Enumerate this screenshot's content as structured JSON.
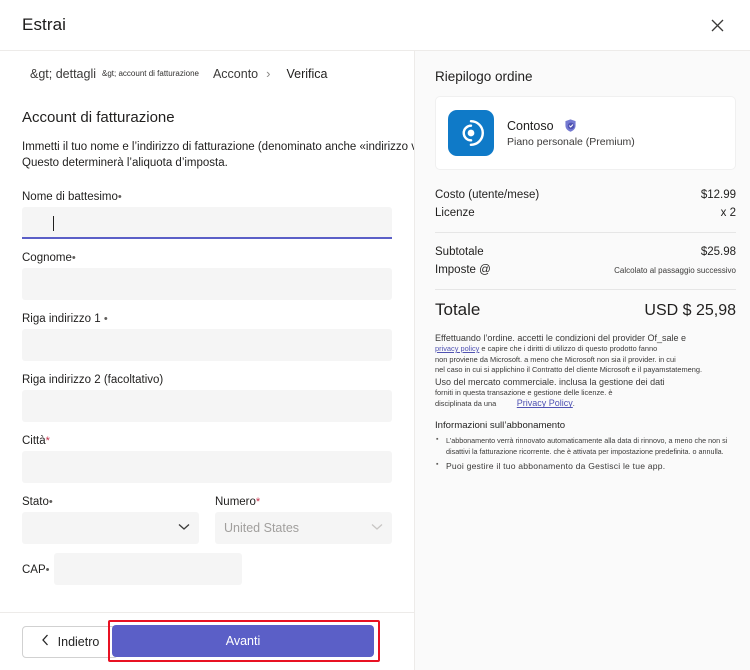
{
  "window": {
    "title": "Estrai",
    "close_icon": "close-icon"
  },
  "breadcrumb": {
    "items": [
      {
        "label": "&gt; dettagli",
        "style": "lg"
      },
      {
        "label": "&gt; account di fatturazione",
        "style": "small"
      },
      {
        "label": "Acconto",
        "style": "lg"
      },
      {
        "label": "Verifica",
        "style": "lg"
      }
    ],
    "separator": "›"
  },
  "form": {
    "section_title": "Account di fatturazione",
    "description_line1": "Immetti il tuo nome e l’indirizzo di fatturazione (denominato anche «indirizzo venduto a»).",
    "description_line2": "Questo determinerà l’aliquota d’imposta.",
    "fields": [
      {
        "label": "Nome di battesimo",
        "required": "•",
        "value": "",
        "type": "text",
        "focused": true
      },
      {
        "label": "Cognome",
        "required": "•",
        "value": "",
        "type": "text",
        "focused": false
      },
      {
        "label": "Riga indirizzo 1",
        "required": "•",
        "value": "",
        "type": "text",
        "focused": false
      },
      {
        "label": "Riga indirizzo 2 (facoltativo)",
        "required": "",
        "value": "",
        "type": "text",
        "focused": false
      },
      {
        "label": "Città",
        "required": "*",
        "value": "",
        "type": "text",
        "focused": false
      }
    ],
    "state_field": {
      "label": "Stato",
      "required": "•",
      "value": ""
    },
    "country_field": {
      "label": "Numero",
      "required": "*",
      "value": "United States",
      "disabled": true
    },
    "zip_field": {
      "label": "CAP",
      "required": "•",
      "value": ""
    },
    "chevron_icon": "chevron-down-icon"
  },
  "footer": {
    "back_label": "Indietro",
    "back_icon": "chevron-left-icon",
    "next_label": "Avanti",
    "next_color": "#5b5fc7",
    "annotation_color": "#e81123"
  },
  "summary": {
    "title": "Riepilogo ordine",
    "product": {
      "name": "Contoso",
      "plan": "Piano personale (Premium)",
      "icon": "contoso-swirl-icon",
      "icon_color": "#0f7ac8",
      "verified_icon": "verified-shield-icon",
      "verified_color": "#5b5fc7"
    },
    "lines": [
      {
        "label": "Costo (utente/mese)",
        "value": "$12.99",
        "small": false
      },
      {
        "label": "Licenze",
        "value": "x  2",
        "small": false
      }
    ],
    "subtotal_lines": [
      {
        "label": "Subtotale",
        "value": "$25.98",
        "small": false
      },
      {
        "label": "Imposte @",
        "value": "Calcolato al passaggio successivo",
        "small": true
      }
    ],
    "total_label": "Totale",
    "total_value": "USD $ 25,98",
    "legal": {
      "line1": "Effettuando l’ordine. accetti le condizioni del provider Of_sale e",
      "line2_link": "privacy policy",
      "line2_rest": " e capire che i diritti di utilizzo di questo prodotto fanno",
      "line3": "non proviene da Microsoft. a meno che Microsoft non sia il provider. in cui",
      "line4": "nel caso in cui si applichino il Contratto del cliente Microsoft e il payamstatemeng.",
      "line5": "Uso del mercato commerciale. inclusa la gestione dei dati",
      "line6": "forniti in questa transazione e gestione delle licenze. è",
      "line7_pre": "disciplinata da una",
      "line7_link": "Privacy Policy",
      "line7_post": "."
    },
    "subscription": {
      "title": "Informazioni sull’abbonamento",
      "items": [
        {
          "line1": "L’abbonamento verrà rinnovato automaticamente alla data di rinnovo, a meno che non si",
          "line2": "disattivi la fatturazione ricorrente. che è attivata per impostazione predefinita. o annulla."
        },
        {
          "line1": "Puoi  gestire il  tuo  abbonamento da  Gestisci  le tue  app.",
          "line2": ""
        }
      ]
    }
  }
}
